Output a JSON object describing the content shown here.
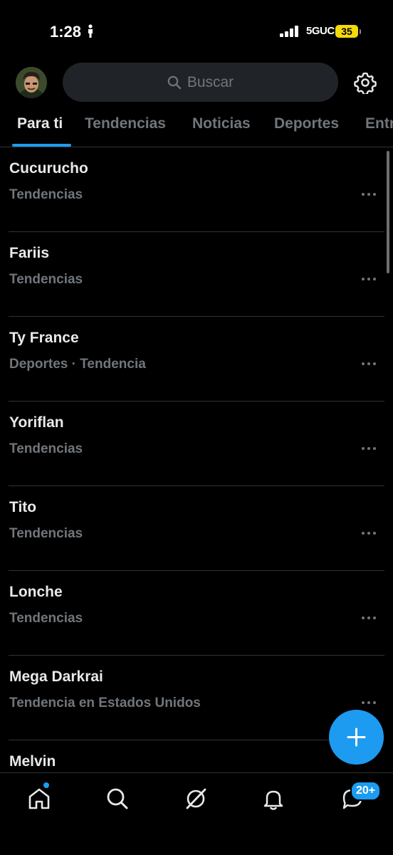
{
  "status_bar": {
    "time": "1:28",
    "network": "5GUC",
    "battery": "35"
  },
  "search": {
    "placeholder": "Buscar"
  },
  "tabs": [
    {
      "label": "Para ti",
      "active": true
    },
    {
      "label": "Tendencias",
      "active": false
    },
    {
      "label": "Noticias",
      "active": false
    },
    {
      "label": "Deportes",
      "active": false
    },
    {
      "label": "Entr",
      "active": false
    }
  ],
  "trends": [
    {
      "title": "Cucurucho",
      "meta": "Tendencias"
    },
    {
      "title": "Fariis",
      "meta": "Tendencias"
    },
    {
      "title": "Ty France",
      "meta": "Deportes · Tendencia"
    },
    {
      "title": "Yoriflan",
      "meta": "Tendencias"
    },
    {
      "title": "Tito",
      "meta": "Tendencias"
    },
    {
      "title": "Lonche",
      "meta": "Tendencias"
    },
    {
      "title": "Mega Darkrai",
      "meta": "Tendencia en Estados Unidos"
    },
    {
      "title": "Melvin",
      "meta": ""
    }
  ],
  "bottom_nav": {
    "items": [
      "home-icon",
      "search-icon",
      "grok-icon",
      "bell-icon",
      "messages-icon"
    ],
    "messages_badge": "20+"
  },
  "colors": {
    "accent": "#1d9bf0",
    "background": "#000000",
    "text_primary": "#e7e9ea",
    "text_secondary": "#71767b",
    "divider": "#2f3336"
  }
}
